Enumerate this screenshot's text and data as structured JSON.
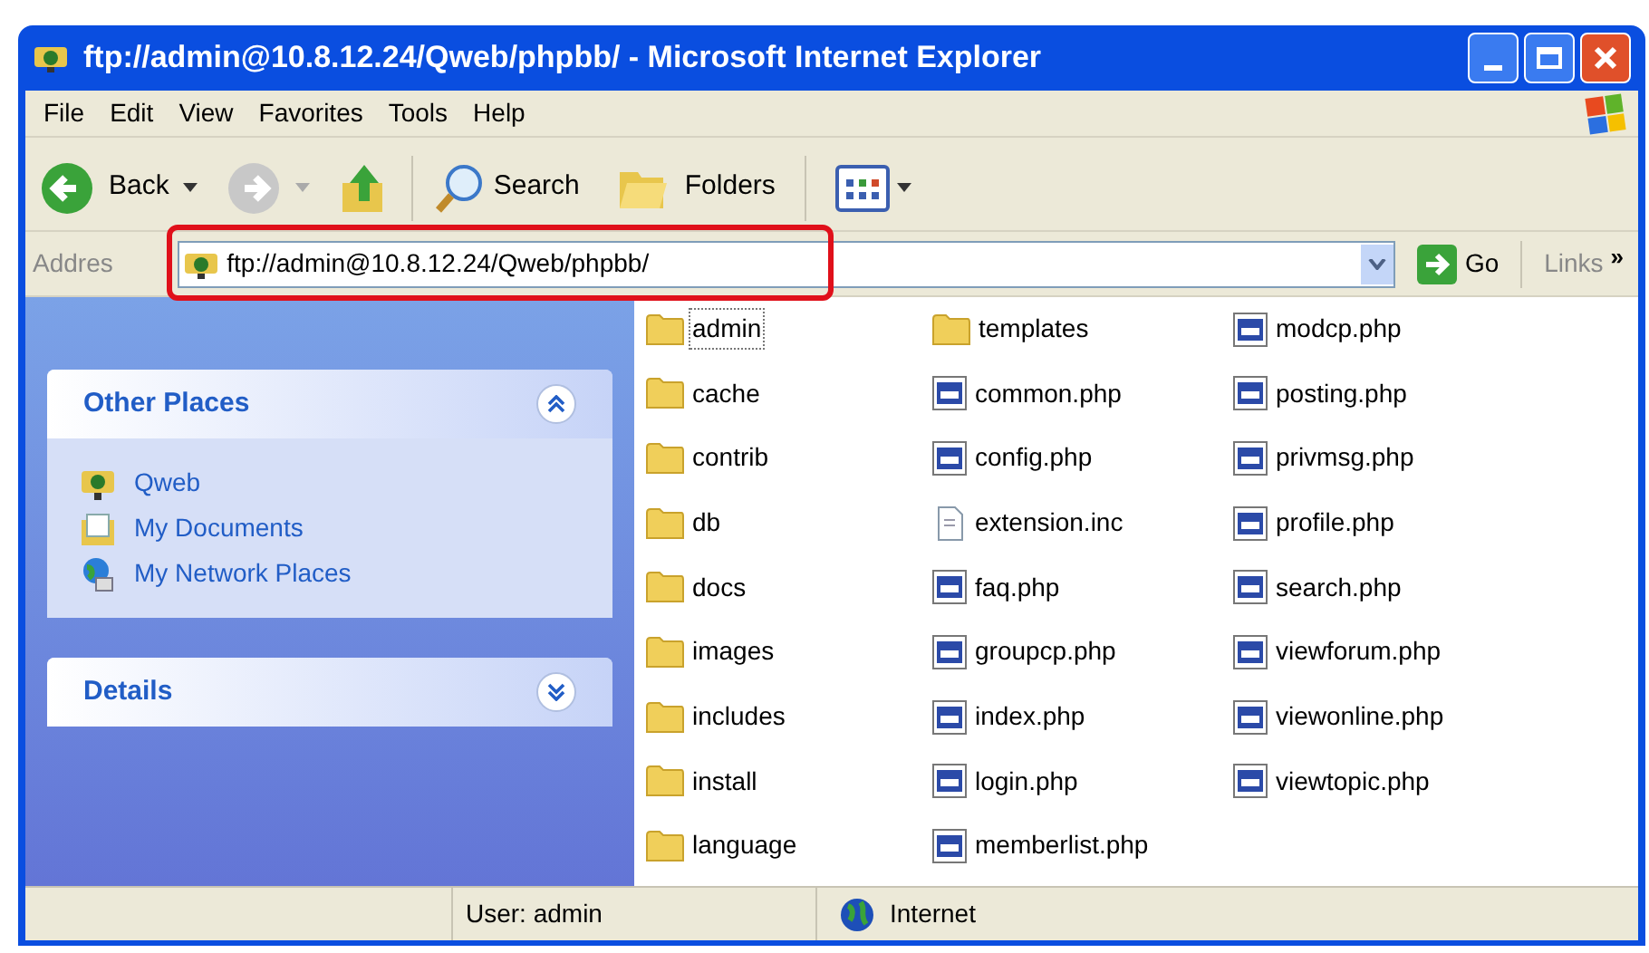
{
  "window": {
    "title": "ftp://admin@10.8.12.24/Qweb/phpbb/ - Microsoft Internet Explorer"
  },
  "menu": [
    "File",
    "Edit",
    "View",
    "Favorites",
    "Tools",
    "Help"
  ],
  "toolbar": {
    "back": "Back",
    "search": "Search",
    "folders": "Folders"
  },
  "address": {
    "label": "Addres",
    "value": "ftp://admin@10.8.12.24/Qweb/phpbb/",
    "go": "Go",
    "links": "Links",
    "more": "»"
  },
  "sidebar": [
    {
      "title": "Other Places",
      "expanded": true,
      "items": [
        {
          "label": "Qweb",
          "kind": "ftp"
        },
        {
          "label": "My Documents",
          "kind": "documents"
        },
        {
          "label": "My Network Places",
          "kind": "network"
        }
      ]
    },
    {
      "title": "Details",
      "expanded": false
    }
  ],
  "files": [
    {
      "name": "admin",
      "kind": "folder",
      "selected": true
    },
    {
      "name": "cache",
      "kind": "folder",
      "selected": false
    },
    {
      "name": "contrib",
      "kind": "folder",
      "selected": false
    },
    {
      "name": "db",
      "kind": "folder",
      "selected": false
    },
    {
      "name": "docs",
      "kind": "folder",
      "selected": false
    },
    {
      "name": "images",
      "kind": "folder",
      "selected": false
    },
    {
      "name": "includes",
      "kind": "folder",
      "selected": false
    },
    {
      "name": "install",
      "kind": "folder",
      "selected": false
    },
    {
      "name": "language",
      "kind": "folder",
      "selected": false
    },
    {
      "name": "templates",
      "kind": "folder",
      "selected": false
    },
    {
      "name": "common.php",
      "kind": "script",
      "selected": false
    },
    {
      "name": "config.php",
      "kind": "script",
      "selected": false
    },
    {
      "name": "extension.inc",
      "kind": "file",
      "selected": false
    },
    {
      "name": "faq.php",
      "kind": "script",
      "selected": false
    },
    {
      "name": "groupcp.php",
      "kind": "script",
      "selected": false
    },
    {
      "name": "index.php",
      "kind": "script",
      "selected": false
    },
    {
      "name": "login.php",
      "kind": "script",
      "selected": false
    },
    {
      "name": "memberlist.php",
      "kind": "script",
      "selected": false
    },
    {
      "name": "modcp.php",
      "kind": "script",
      "selected": false
    },
    {
      "name": "posting.php",
      "kind": "script",
      "selected": false
    },
    {
      "name": "privmsg.php",
      "kind": "script",
      "selected": false
    },
    {
      "name": "profile.php",
      "kind": "script",
      "selected": false
    },
    {
      "name": "search.php",
      "kind": "script",
      "selected": false
    },
    {
      "name": "viewforum.php",
      "kind": "script",
      "selected": false
    },
    {
      "name": "viewonline.php",
      "kind": "script",
      "selected": false
    },
    {
      "name": "viewtopic.php",
      "kind": "script",
      "selected": false
    }
  ],
  "status_bar": {
    "user": "User: admin",
    "zone": "Internet"
  }
}
